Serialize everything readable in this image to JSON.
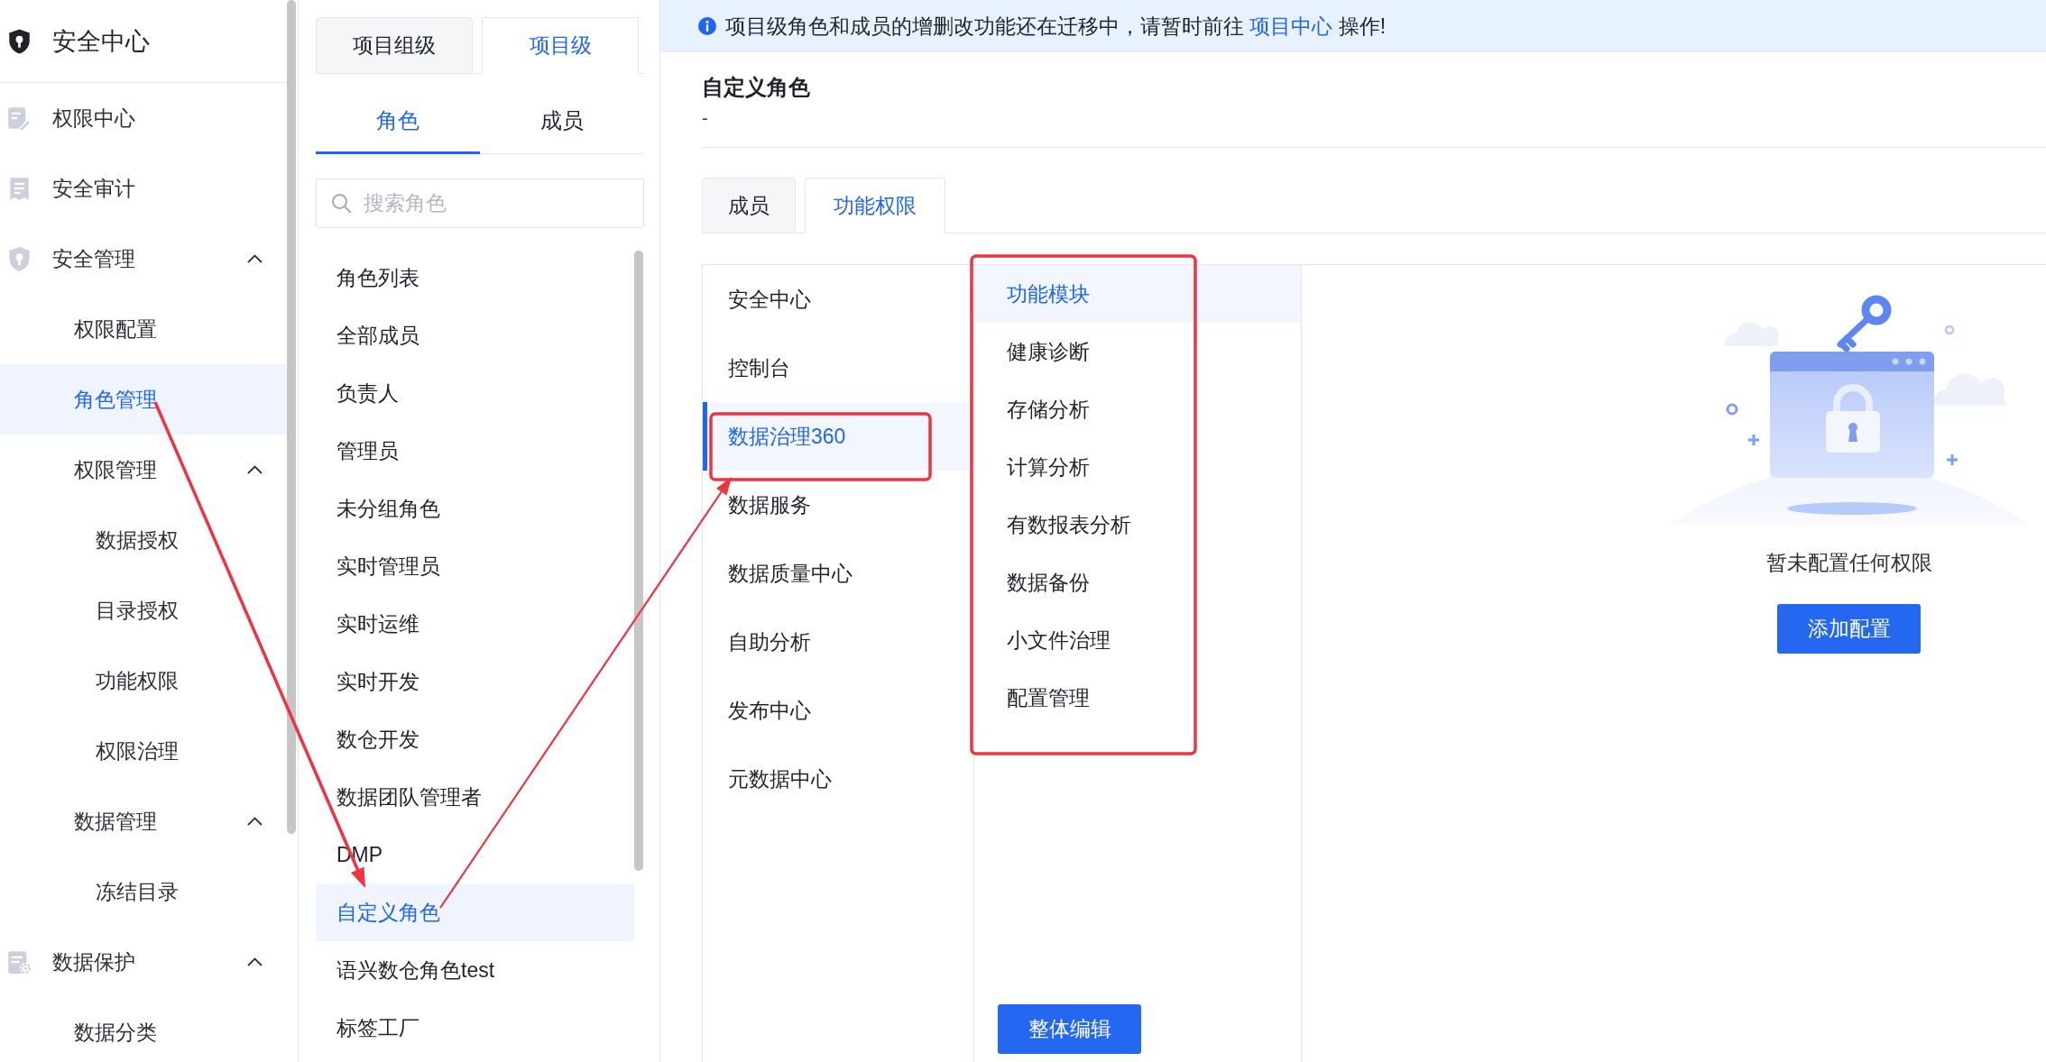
{
  "sidebar": {
    "title": "安全中心",
    "items": [
      {
        "label": "权限中心",
        "selected": false
      },
      {
        "label": "安全审计",
        "selected": false
      },
      {
        "label": "安全管理",
        "selected": false,
        "expanded": true,
        "children": [
          {
            "label": "权限配置",
            "selected": false
          },
          {
            "label": "角色管理",
            "selected": true
          },
          {
            "label": "权限管理",
            "selected": false,
            "expanded": true,
            "children": [
              {
                "label": "数据授权",
                "selected": false
              },
              {
                "label": "目录授权",
                "selected": false
              },
              {
                "label": "功能权限",
                "selected": false
              },
              {
                "label": "权限治理",
                "selected": false
              }
            ]
          },
          {
            "label": "数据管理",
            "selected": false,
            "expanded": true,
            "children": [
              {
                "label": "冻结目录",
                "selected": false
              }
            ]
          }
        ]
      },
      {
        "label": "数据保护",
        "selected": false,
        "expanded": true,
        "children": [
          {
            "label": "数据分类",
            "selected": false
          }
        ]
      }
    ]
  },
  "scope_tabs": [
    {
      "label": "项目组级",
      "selected": false
    },
    {
      "label": "项目级",
      "selected": true
    }
  ],
  "role_tabs": [
    {
      "label": "角色",
      "selected": true
    },
    {
      "label": "成员",
      "selected": false
    }
  ],
  "role_search": {
    "placeholder": "搜索角色"
  },
  "roles": [
    {
      "label": "角色列表",
      "selected": false
    },
    {
      "label": "全部成员",
      "selected": false
    },
    {
      "label": "负责人",
      "selected": false
    },
    {
      "label": "管理员",
      "selected": false
    },
    {
      "label": "未分组角色",
      "selected": false
    },
    {
      "label": "实时管理员",
      "selected": false
    },
    {
      "label": "实时运维",
      "selected": false
    },
    {
      "label": "实时开发",
      "selected": false
    },
    {
      "label": "数仓开发",
      "selected": false
    },
    {
      "label": "数据团队管理者",
      "selected": false
    },
    {
      "label": "DMP",
      "selected": false
    },
    {
      "label": "自定义角色",
      "selected": true
    },
    {
      "label": "语兴数仓角色test",
      "selected": false
    },
    {
      "label": "标签工厂",
      "selected": false
    }
  ],
  "notice": {
    "text": "项目级角色和成员的增删改功能还在迁移中，请暂时前往",
    "link": "项目中心",
    "text_after": "操作!"
  },
  "role_detail": {
    "title": "自定义角色",
    "description": "-"
  },
  "detail_tabs": [
    {
      "label": "成员",
      "selected": false
    },
    {
      "label": "功能权限",
      "selected": true
    }
  ],
  "products": [
    {
      "label": "安全中心",
      "selected": false
    },
    {
      "label": "控制台",
      "selected": false
    },
    {
      "label": "数据治理360",
      "selected": true
    },
    {
      "label": "数据服务",
      "selected": false
    },
    {
      "label": "数据质量中心",
      "selected": false
    },
    {
      "label": "自助分析",
      "selected": false
    },
    {
      "label": "发布中心",
      "selected": false
    },
    {
      "label": "元数据中心",
      "selected": false
    }
  ],
  "modules": [
    {
      "label": "功能模块",
      "selected": true
    },
    {
      "label": "健康诊断",
      "selected": false
    },
    {
      "label": "存储分析",
      "selected": false
    },
    {
      "label": "计算分析",
      "selected": false
    },
    {
      "label": "有数报表分析",
      "selected": false
    },
    {
      "label": "数据备份",
      "selected": false
    },
    {
      "label": "小文件治理",
      "selected": false
    },
    {
      "label": "配置管理",
      "selected": false
    }
  ],
  "edit_button": "整体编辑",
  "empty_state": {
    "message": "暂未配置任何权限",
    "button": "添加配置"
  }
}
